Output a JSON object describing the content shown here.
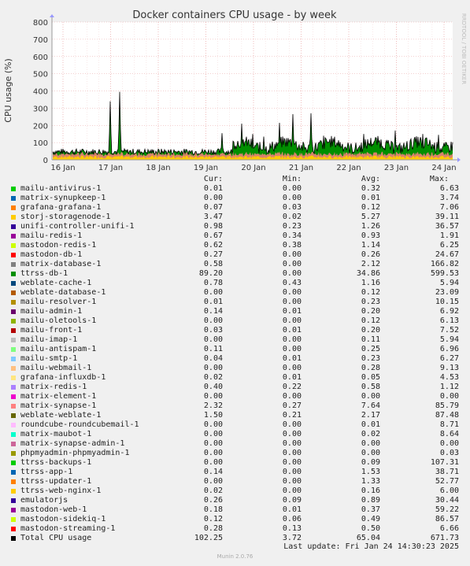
{
  "chart_data": {
    "type": "area",
    "title": "Docker containers CPU usage - by week",
    "ylabel": "CPU usage (%)",
    "xlabel": "",
    "ylim": [
      0,
      800
    ],
    "yticks": [
      "0",
      "100",
      "200",
      "300",
      "400",
      "500",
      "600",
      "700",
      "800"
    ],
    "xticks": [
      "16 Jan",
      "17 Jan",
      "18 Jan",
      "19 Jan",
      "20 Jan",
      "21 Jan",
      "22 Jan",
      "23 Jan",
      "24 Jan"
    ],
    "grid": true,
    "side_label": "RRDTOOL / TOBI OETIKER",
    "columns": {
      "cur": "Cur:",
      "min": "Min:",
      "avg": "Avg:",
      "max": "Max:"
    },
    "series": [
      {
        "name": "mailu-antivirus-1",
        "color": "#00cc00",
        "cur": "0.01",
        "min": "0.00",
        "avg": "0.32",
        "max": "6.63"
      },
      {
        "name": "matrix-synupkeep-1",
        "color": "#0066b3",
        "cur": "0.00",
        "min": "0.00",
        "avg": "0.01",
        "max": "3.74"
      },
      {
        "name": "grafana-grafana-1",
        "color": "#ff8000",
        "cur": "0.07",
        "min": "0.03",
        "avg": "0.12",
        "max": "7.06"
      },
      {
        "name": "storj-storagenode-1",
        "color": "#ffcc00",
        "cur": "3.47",
        "min": "0.02",
        "avg": "5.27",
        "max": "39.11"
      },
      {
        "name": "unifi-controller-unifi-1",
        "color": "#330099",
        "cur": "0.98",
        "min": "0.23",
        "avg": "1.26",
        "max": "36.57"
      },
      {
        "name": "mailu-redis-1",
        "color": "#990099",
        "cur": "0.67",
        "min": "0.34",
        "avg": "0.93",
        "max": "1.91"
      },
      {
        "name": "mastodon-redis-1",
        "color": "#ccff00",
        "cur": "0.62",
        "min": "0.38",
        "avg": "1.14",
        "max": "6.25"
      },
      {
        "name": "mastodon-db-1",
        "color": "#ff0000",
        "cur": "0.27",
        "min": "0.00",
        "avg": "0.26",
        "max": "24.67"
      },
      {
        "name": "matrix-database-1",
        "color": "#808080",
        "cur": "0.58",
        "min": "0.00",
        "avg": "2.12",
        "max": "166.82"
      },
      {
        "name": "ttrss-db-1",
        "color": "#008f00",
        "cur": "89.20",
        "min": "0.00",
        "avg": "34.86",
        "max": "599.53"
      },
      {
        "name": "weblate-cache-1",
        "color": "#00487d",
        "cur": "0.78",
        "min": "0.43",
        "avg": "1.16",
        "max": "5.94"
      },
      {
        "name": "weblate-database-1",
        "color": "#b35a00",
        "cur": "0.00",
        "min": "0.00",
        "avg": "0.12",
        "max": "23.09"
      },
      {
        "name": "mailu-resolver-1",
        "color": "#b38f00",
        "cur": "0.01",
        "min": "0.00",
        "avg": "0.23",
        "max": "10.15"
      },
      {
        "name": "mailu-admin-1",
        "color": "#6b006b",
        "cur": "0.14",
        "min": "0.01",
        "avg": "0.20",
        "max": "6.92"
      },
      {
        "name": "mailu-oletools-1",
        "color": "#8fb300",
        "cur": "0.00",
        "min": "0.00",
        "avg": "0.12",
        "max": "6.13"
      },
      {
        "name": "mailu-front-1",
        "color": "#b30000",
        "cur": "0.03",
        "min": "0.01",
        "avg": "0.20",
        "max": "7.52"
      },
      {
        "name": "mailu-imap-1",
        "color": "#bebebe",
        "cur": "0.00",
        "min": "0.00",
        "avg": "0.11",
        "max": "5.94"
      },
      {
        "name": "mailu-antispam-1",
        "color": "#80ff80",
        "cur": "0.11",
        "min": "0.00",
        "avg": "0.25",
        "max": "6.96"
      },
      {
        "name": "mailu-smtp-1",
        "color": "#80c9ff",
        "cur": "0.04",
        "min": "0.01",
        "avg": "0.23",
        "max": "6.27"
      },
      {
        "name": "mailu-webmail-1",
        "color": "#ffc080",
        "cur": "0.00",
        "min": "0.00",
        "avg": "0.28",
        "max": "9.13"
      },
      {
        "name": "grafana-influxdb-1",
        "color": "#ffe680",
        "cur": "0.02",
        "min": "0.01",
        "avg": "0.05",
        "max": "4.53"
      },
      {
        "name": "matrix-redis-1",
        "color": "#aa80ff",
        "cur": "0.40",
        "min": "0.22",
        "avg": "0.58",
        "max": "1.12"
      },
      {
        "name": "matrix-element-1",
        "color": "#ee00cc",
        "cur": "0.00",
        "min": "0.00",
        "avg": "0.00",
        "max": "0.00"
      },
      {
        "name": "matrix-synapse-1",
        "color": "#ff8080",
        "cur": "2.32",
        "min": "0.27",
        "avg": "7.64",
        "max": "85.79"
      },
      {
        "name": "weblate-weblate-1",
        "color": "#666600",
        "cur": "1.50",
        "min": "0.21",
        "avg": "2.17",
        "max": "87.48"
      },
      {
        "name": "roundcube-roundcubemail-1",
        "color": "#ffbbff",
        "cur": "0.00",
        "min": "0.00",
        "avg": "0.01",
        "max": "8.71"
      },
      {
        "name": "matrix-maubot-1",
        "color": "#00ffcc",
        "cur": "0.00",
        "min": "0.00",
        "avg": "0.02",
        "max": "8.64"
      },
      {
        "name": "matrix-synapse-admin-1",
        "color": "#cc6699",
        "cur": "0.00",
        "min": "0.00",
        "avg": "0.00",
        "max": "0.00"
      },
      {
        "name": "phpmyadmin-phpmyadmin-1",
        "color": "#999900",
        "cur": "0.00",
        "min": "0.00",
        "avg": "0.00",
        "max": "0.03"
      },
      {
        "name": "ttrss-backups-1",
        "color": "#00cc00",
        "cur": "0.00",
        "min": "0.00",
        "avg": "0.09",
        "max": "107.31"
      },
      {
        "name": "ttrss-app-1",
        "color": "#0066b3",
        "cur": "0.14",
        "min": "0.00",
        "avg": "1.53",
        "max": "38.71"
      },
      {
        "name": "ttrss-updater-1",
        "color": "#ff8000",
        "cur": "0.00",
        "min": "0.00",
        "avg": "1.33",
        "max": "52.77"
      },
      {
        "name": "ttrss-web-nginx-1",
        "color": "#ffcc00",
        "cur": "0.02",
        "min": "0.00",
        "avg": "0.16",
        "max": "6.00"
      },
      {
        "name": "emulatorjs",
        "color": "#330099",
        "cur": "0.26",
        "min": "0.09",
        "avg": "0.89",
        "max": "30.44"
      },
      {
        "name": "mastodon-web-1",
        "color": "#990099",
        "cur": "0.18",
        "min": "0.01",
        "avg": "0.37",
        "max": "59.22"
      },
      {
        "name": "mastodon-sidekiq-1",
        "color": "#ccff00",
        "cur": "0.12",
        "min": "0.06",
        "avg": "0.49",
        "max": "86.57"
      },
      {
        "name": "mastodon-streaming-1",
        "color": "#ff0000",
        "cur": "0.28",
        "min": "0.13",
        "avg": "0.50",
        "max": "6.66"
      },
      {
        "name": "Total CPU usage",
        "color": "#000000",
        "cur": "102.25",
        "min": "3.72",
        "avg": "65.04",
        "max": "671.73"
      }
    ]
  },
  "footer": {
    "last_update": "Last update: Fri Jan 24 14:30:23 2025",
    "munin_version": "Munin 2.0.76"
  }
}
